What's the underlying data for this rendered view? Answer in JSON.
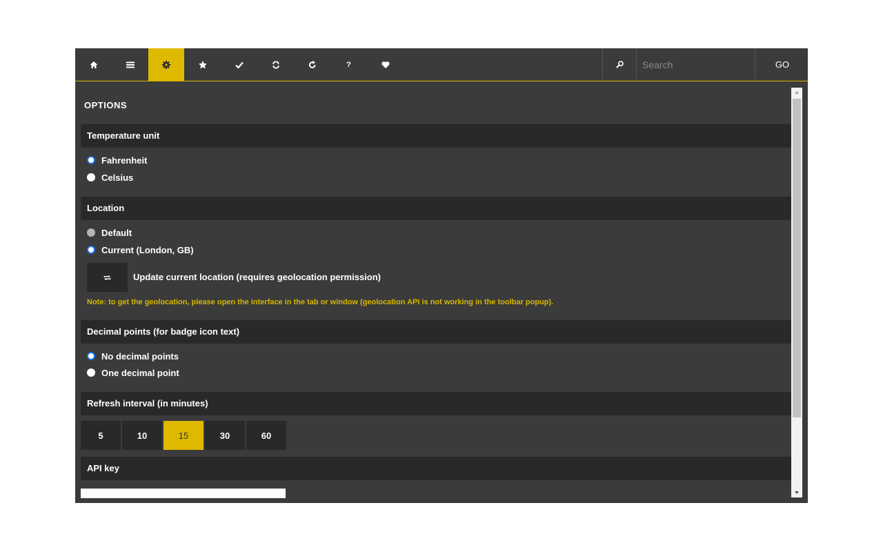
{
  "toolbar": {
    "buttons": [
      {
        "name": "home",
        "icon": "home-icon"
      },
      {
        "name": "menu",
        "icon": "menu-icon"
      },
      {
        "name": "settings",
        "icon": "gear-icon",
        "active": true
      },
      {
        "name": "favorites",
        "icon": "star-icon"
      },
      {
        "name": "check",
        "icon": "check-icon"
      },
      {
        "name": "sync",
        "icon": "sync-icon"
      },
      {
        "name": "refresh",
        "icon": "refresh-icon"
      },
      {
        "name": "help",
        "icon": "question-icon",
        "glyph": "?"
      },
      {
        "name": "favorite",
        "icon": "heart-icon"
      }
    ],
    "search_placeholder": "Search",
    "search_value": "",
    "go_label": "GO"
  },
  "page": {
    "title": "OPTIONS"
  },
  "temperature": {
    "heading": "Temperature unit",
    "options": [
      {
        "label": "Fahrenheit",
        "checked": true
      },
      {
        "label": "Celsius",
        "checked": false
      }
    ]
  },
  "location": {
    "heading": "Location",
    "options": [
      {
        "label": "Default",
        "checked": false,
        "disabled": true
      },
      {
        "label": "Current (London, GB)",
        "checked": true
      }
    ],
    "update_label": "Update current location (requires geolocation permission)",
    "note": "Note: to get the geolocation, please open the interface in the tab or window (geolocation API is not working in the toolbar popup)."
  },
  "decimal": {
    "heading": "Decimal points (for badge icon text)",
    "options": [
      {
        "label": "No decimal points",
        "checked": true
      },
      {
        "label": "One decimal point",
        "checked": false
      }
    ]
  },
  "refresh": {
    "heading": "Refresh interval (in minutes)",
    "options": [
      "5",
      "10",
      "15",
      "30",
      "60"
    ],
    "selected": "15"
  },
  "api": {
    "heading": "API key",
    "value": ""
  },
  "colors": {
    "accent": "#ddb900",
    "background": "#3b3b3b",
    "header_bg": "#292929",
    "note_text": "#d7b600"
  }
}
